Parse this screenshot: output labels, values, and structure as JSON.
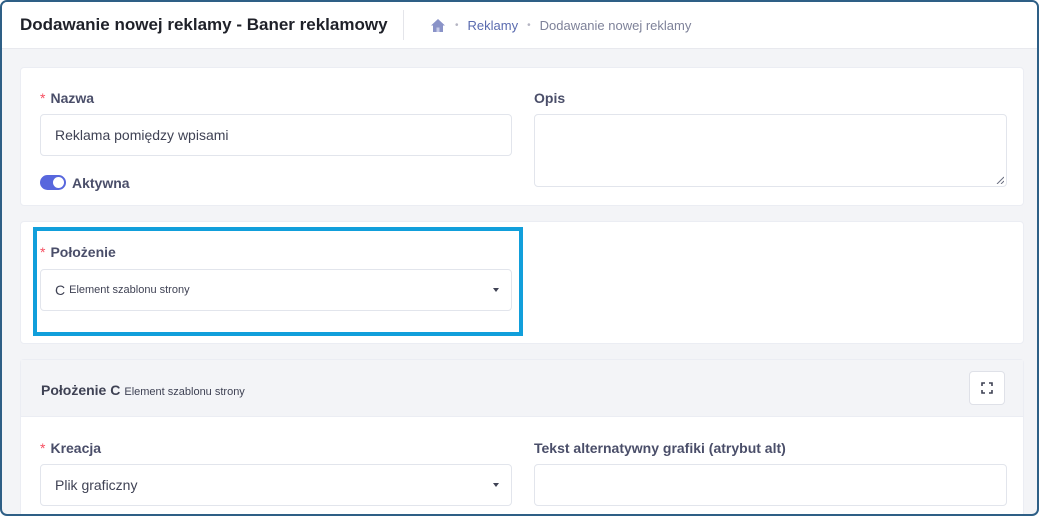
{
  "header": {
    "title": "Dodawanie nowej reklamy - Baner reklamowy",
    "breadcrumb": {
      "home_icon": "home-icon",
      "items": [
        "Reklamy",
        "Dodawanie nowej reklamy"
      ]
    }
  },
  "form": {
    "nazwa": {
      "label": "Nazwa",
      "required_mark": "*",
      "value": "Reklama pomiędzy wpisami"
    },
    "opis": {
      "label": "Opis",
      "value": ""
    },
    "aktywna": {
      "label": "Aktywna",
      "checked": true
    },
    "polozenie": {
      "label": "Położenie",
      "required_mark": "*",
      "selected_main": "C",
      "selected_sub": "Element szablonu strony"
    }
  },
  "section": {
    "title_main": "Położenie C",
    "title_sub": "Element szablonu strony",
    "fullscreen_icon": "expand-icon",
    "kreacja": {
      "label": "Kreacja",
      "required_mark": "*",
      "selected": "Plik graficzny"
    },
    "alt_text": {
      "label": "Tekst alternatywny grafiki (atrybut alt)",
      "value": ""
    }
  },
  "colors": {
    "accent": "#5867dd",
    "highlight": "#119fdb",
    "required": "#f64e60",
    "frame": "#2e5f86"
  }
}
